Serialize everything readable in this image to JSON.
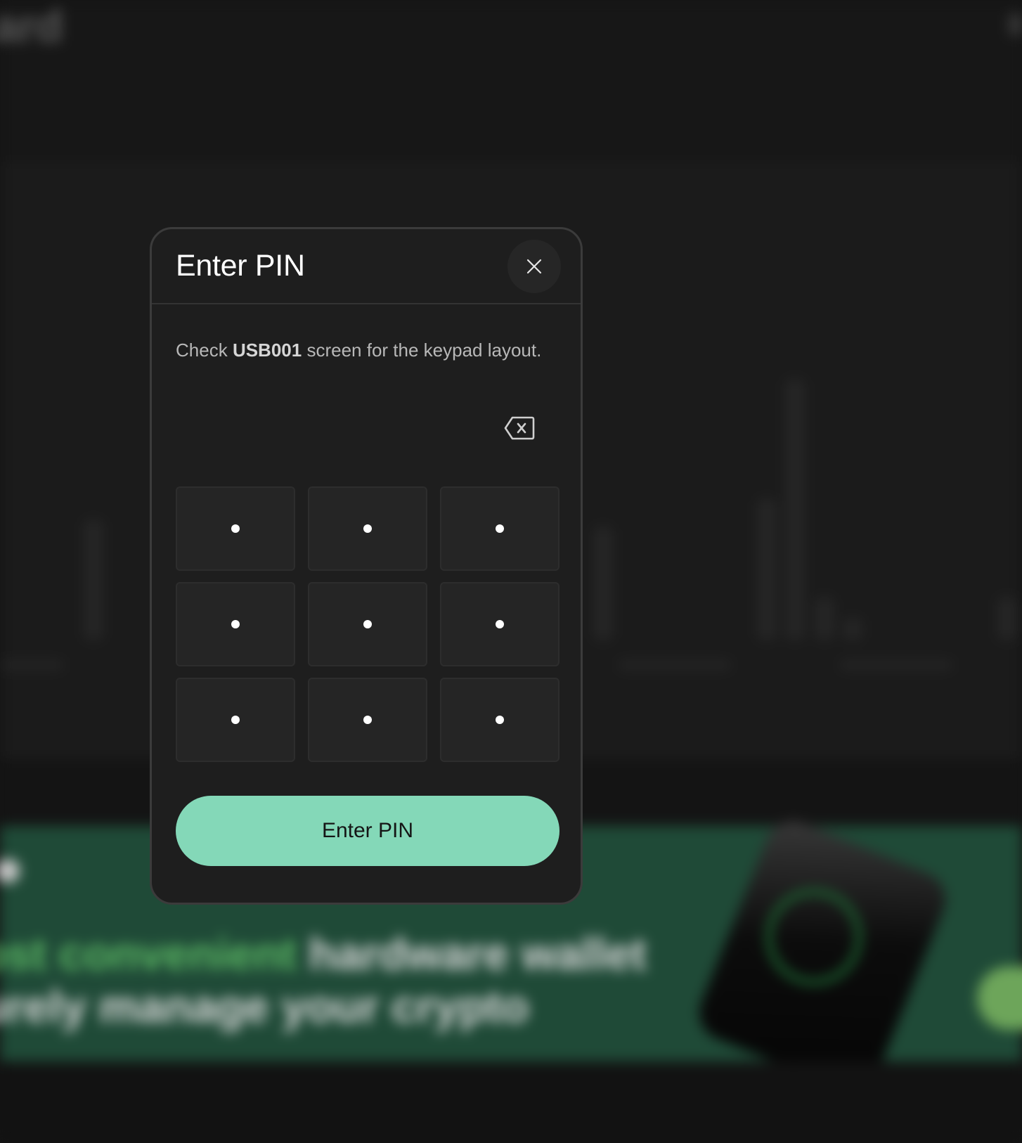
{
  "modal": {
    "title": "Enter PIN",
    "close_icon": "close-icon",
    "instruction": {
      "prefix": "Check",
      "device_name": "USB001",
      "suffix": "screen for the keypad layout."
    },
    "backspace_icon": "backspace-icon",
    "keypad": {
      "keys": [
        {
          "symbol": "•"
        },
        {
          "symbol": "•"
        },
        {
          "symbol": "•"
        },
        {
          "symbol": "•"
        },
        {
          "symbol": "•"
        },
        {
          "symbol": "•"
        },
        {
          "symbol": "•"
        },
        {
          "symbol": "•"
        },
        {
          "symbol": "•"
        }
      ]
    },
    "submit_label": "Enter PIN"
  },
  "background": {
    "logo_text": "ard",
    "headline_line1_accent": "ost convenient",
    "headline_line1_rest": " hardware wallet",
    "headline_line2": "urely manage your crypto"
  },
  "colors": {
    "modal_bg": "#1e1e1e",
    "accent": "#84d8b8",
    "banner": "#1f4a37",
    "text_primary": "#ffffff",
    "text_secondary": "#b8b8b8"
  }
}
